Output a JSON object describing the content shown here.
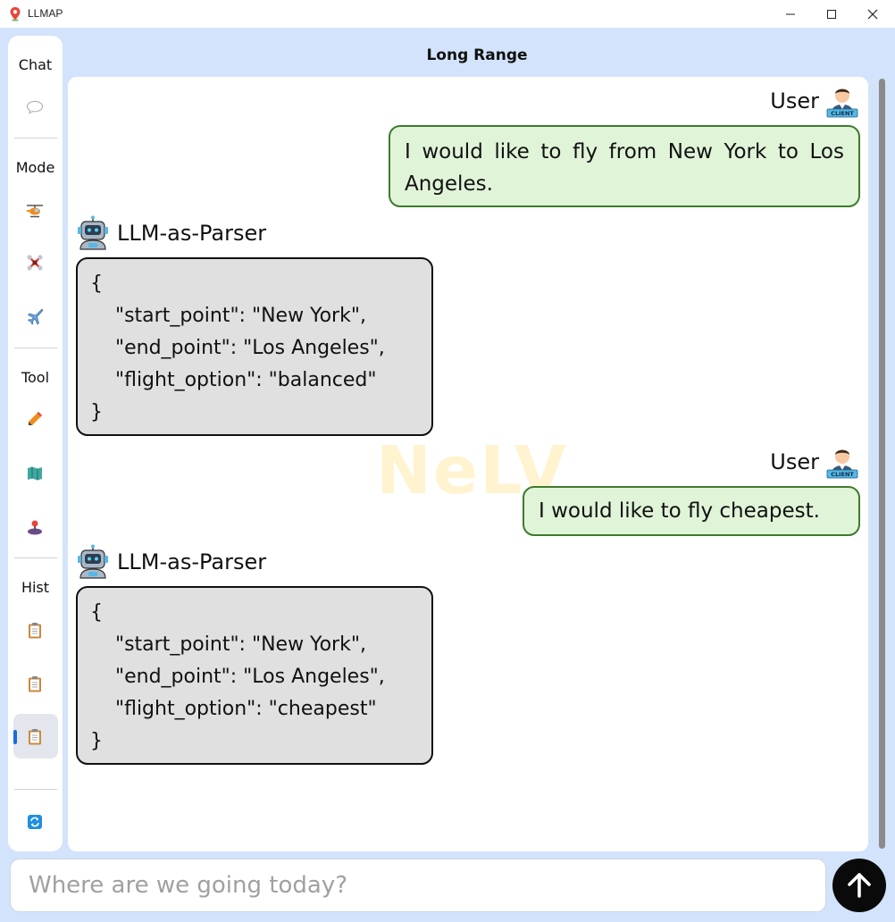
{
  "window": {
    "title": "LLMAP"
  },
  "header": {
    "title": "Long Range"
  },
  "watermark": "NeLV",
  "sidebar": {
    "sections": {
      "chat": "Chat",
      "mode": "Mode",
      "tool": "Tool",
      "hist": "Hist"
    },
    "icons": [
      "speech-bubble-icon",
      "helicopter-icon",
      "drone-icon",
      "airplane-icon",
      "pencil-icon",
      "map-icon",
      "joystick-icon",
      "clipboard-icon",
      "clipboard-icon",
      "clipboard-icon",
      "refresh-icon"
    ]
  },
  "messages": [
    {
      "speaker": "User",
      "text": "I would like to fly from New York to Los Angeles."
    },
    {
      "speaker": "LLM-as-Parser",
      "text": "{\n    \"start_point\": \"New York\",\n    \"end_point\": \"Los Angeles\",\n    \"flight_option\": \"balanced\"\n}"
    },
    {
      "speaker": "User",
      "text": "I would like to fly cheapest."
    },
    {
      "speaker": "LLM-as-Parser",
      "text": "{\n    \"start_point\": \"New York\",\n    \"end_point\": \"Los Angeles\",\n    \"flight_option\": \"cheapest\"\n}"
    }
  ],
  "avatar_badge": "CLIENT",
  "input": {
    "placeholder": "Where are we going today?",
    "value": ""
  },
  "colors": {
    "accent": "#1a6fd6",
    "user_bubble": "#e0f4d8",
    "user_border": "#3e7a2e",
    "llm_bubble": "#e0e0e0",
    "background": "#d3e3fb"
  }
}
